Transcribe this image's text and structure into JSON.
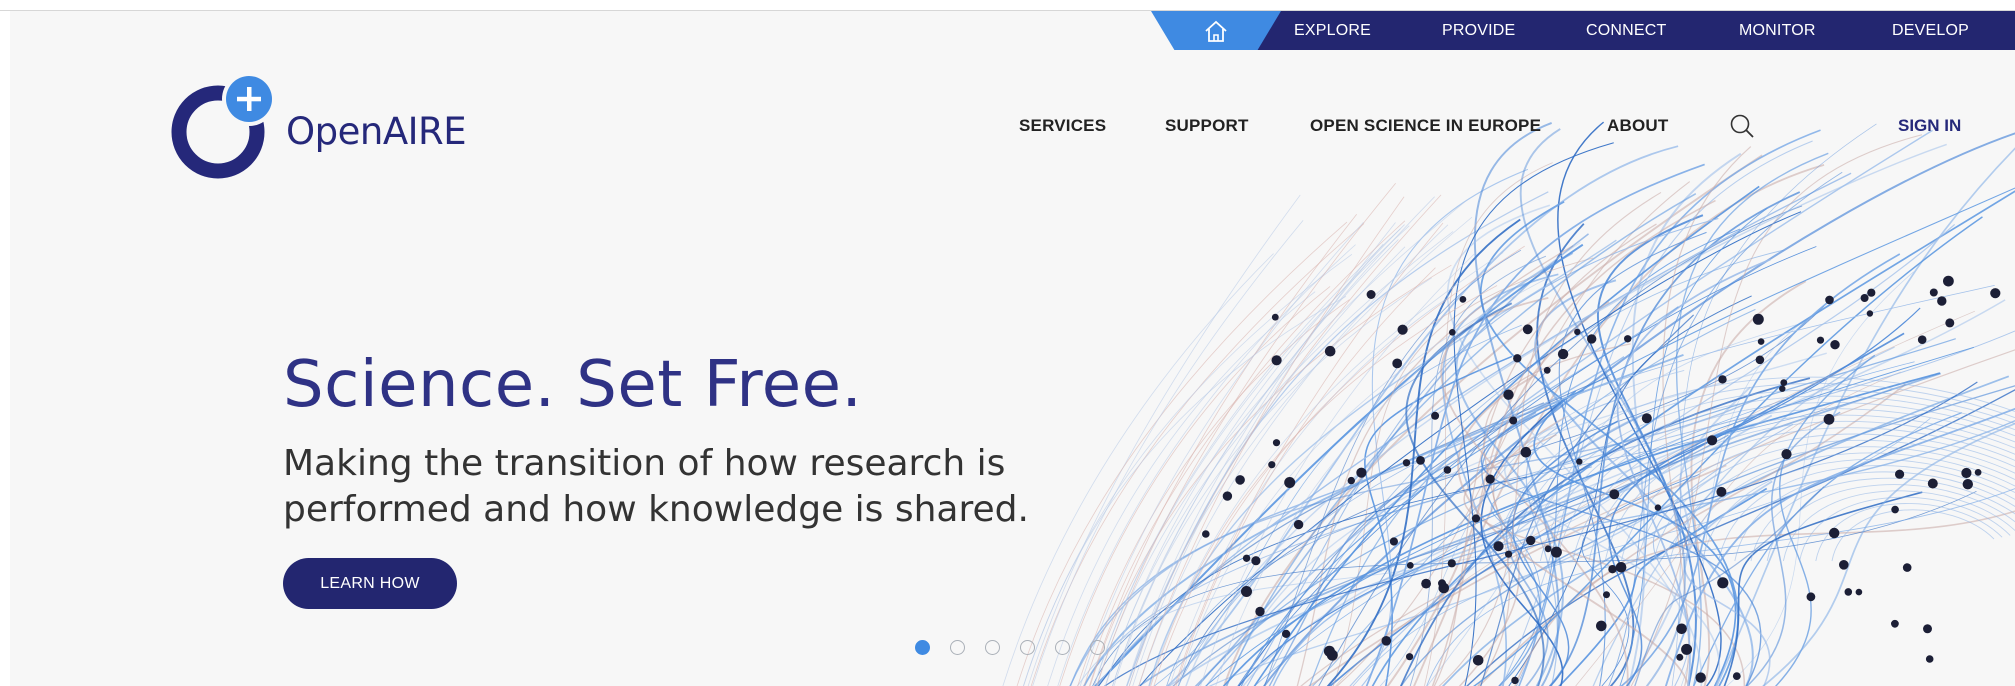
{
  "colors": {
    "brand_navy": "#232670",
    "accent_blue": "#3f8ae2",
    "background": "#f7f7f7"
  },
  "topnav": {
    "home_icon": "home-icon",
    "items": [
      "EXPLORE",
      "PROVIDE",
      "CONNECT",
      "MONITOR",
      "DEVELOP"
    ]
  },
  "logo": {
    "text": "OpenAIRE"
  },
  "mainnav": {
    "items": [
      "SERVICES",
      "SUPPORT",
      "OPEN SCIENCE IN EUROPE",
      "ABOUT"
    ],
    "search_icon": "search-icon",
    "signin": "SIGN IN"
  },
  "hero": {
    "title": "Science. Set Free.",
    "subtitle_line1": "Making the transition of how research is",
    "subtitle_line2": "performed and how knowledge is shared.",
    "button": "LEARN HOW"
  },
  "carousel": {
    "count": 6,
    "active_index": 0
  }
}
